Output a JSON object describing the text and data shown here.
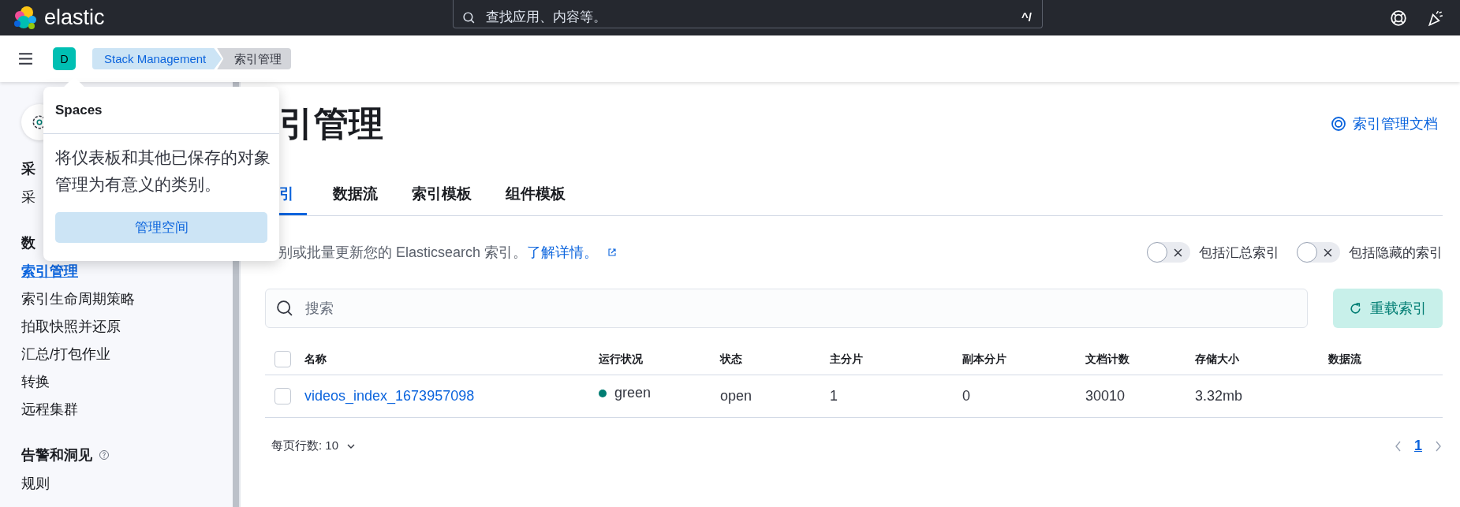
{
  "top_bar": {
    "logo_text": "elastic",
    "search": {
      "placeholder": "查找应用、内容等。",
      "shortcut": "^/"
    }
  },
  "header": {
    "avatar": "D",
    "breadcrumbs": [
      {
        "label": "Stack Management",
        "selected": false
      },
      {
        "label": "索引管理",
        "selected": true
      }
    ]
  },
  "sidebar": {
    "sections": [
      {
        "title": "采",
        "has_help": false,
        "items": [
          {
            "label": "采",
            "selected": false
          }
        ]
      },
      {
        "title": "数",
        "has_help": false,
        "items": [
          {
            "label": "索引管理",
            "selected": true
          },
          {
            "label": "索引生命周期策略",
            "selected": false
          },
          {
            "label": "拍取快照并还原",
            "selected": false
          },
          {
            "label": "汇总/打包作业",
            "selected": false
          },
          {
            "label": "转换",
            "selected": false
          },
          {
            "label": "远程集群",
            "selected": false
          }
        ]
      },
      {
        "title": "告警和洞见",
        "has_help": true,
        "items": [
          {
            "label": "规则",
            "selected": false
          }
        ]
      }
    ]
  },
  "popover": {
    "title": "Spaces",
    "text": "将仪表板和其他已保存的对象管理为有意义的类别。",
    "button": "管理空间"
  },
  "page": {
    "title": "引管理",
    "doc_link": "索引管理文档",
    "tabs": [
      {
        "label": "引",
        "selected": true
      },
      {
        "label": "数据流",
        "selected": false
      },
      {
        "label": "索引模板",
        "selected": false
      },
      {
        "label": "组件模板",
        "selected": false
      }
    ],
    "description": "别或批量更新您的 Elasticsearch 索引。",
    "learn_more": "了解详情。",
    "toggles": [
      {
        "label": "包括汇总索引",
        "on": false
      },
      {
        "label": "包括隐藏的索引",
        "on": false
      }
    ],
    "search": {
      "placeholder": "搜索"
    },
    "reload_button": "重载索引"
  },
  "table": {
    "header_checked": false,
    "columns": [
      "名称",
      "运行状况",
      "状态",
      "主分片",
      "副本分片",
      "文档计数",
      "存储大小",
      "数据流"
    ],
    "rows": [
      {
        "checked": false,
        "name": "videos_index_1673957098",
        "health": {
          "label": "green",
          "color": "#017d73"
        },
        "status": "open",
        "primaries": "1",
        "replicas": "0",
        "docs_count": "30010",
        "storage_size": "3.32mb"
      }
    ]
  },
  "pagination": {
    "rows_per_page": "每页行数: 10",
    "pages": [
      {
        "label": "1",
        "selected": true
      }
    ]
  }
}
